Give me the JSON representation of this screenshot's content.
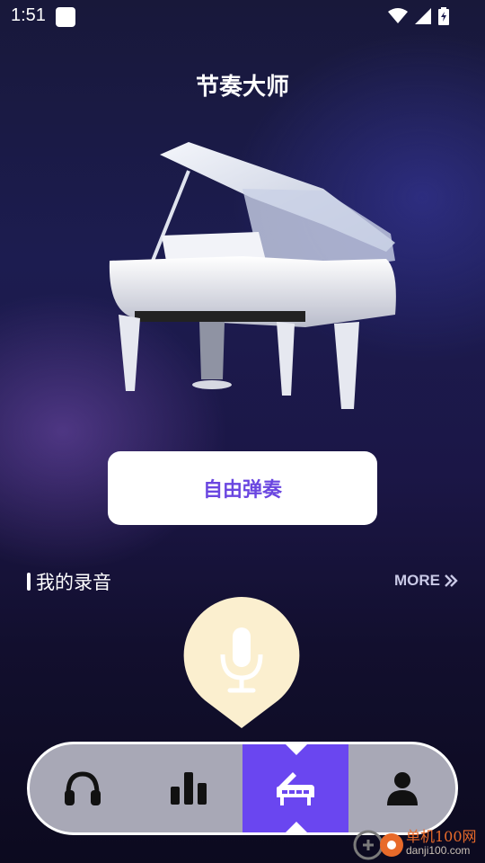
{
  "status_bar": {
    "time": "1:51",
    "icons": [
      "app-notification-icon",
      "wifi-icon",
      "signal-icon",
      "battery-charging-icon"
    ]
  },
  "header": {
    "title": "节奏大师"
  },
  "hero": {
    "image": "grand-piano-image"
  },
  "main": {
    "free_play_label": "自由弹奏",
    "recordings_title": "我的录音",
    "more_label": "MORE"
  },
  "record": {
    "icon": "microphone-icon",
    "bubble_color": "#fbefcf"
  },
  "tab_bar": {
    "tabs": [
      {
        "icon": "headphones-icon",
        "active": false
      },
      {
        "icon": "bar-chart-icon",
        "active": false
      },
      {
        "icon": "piano-icon",
        "active": true
      },
      {
        "icon": "user-icon",
        "active": false
      }
    ],
    "active_color": "#6a46f0",
    "bar_color": "#a8a8b6"
  },
  "watermark": {
    "name": "单机100网",
    "url": "danji100.com"
  },
  "colors": {
    "accent": "#6a46e0",
    "background_top": "#18183a",
    "background_bottom": "#0c0a1f"
  }
}
